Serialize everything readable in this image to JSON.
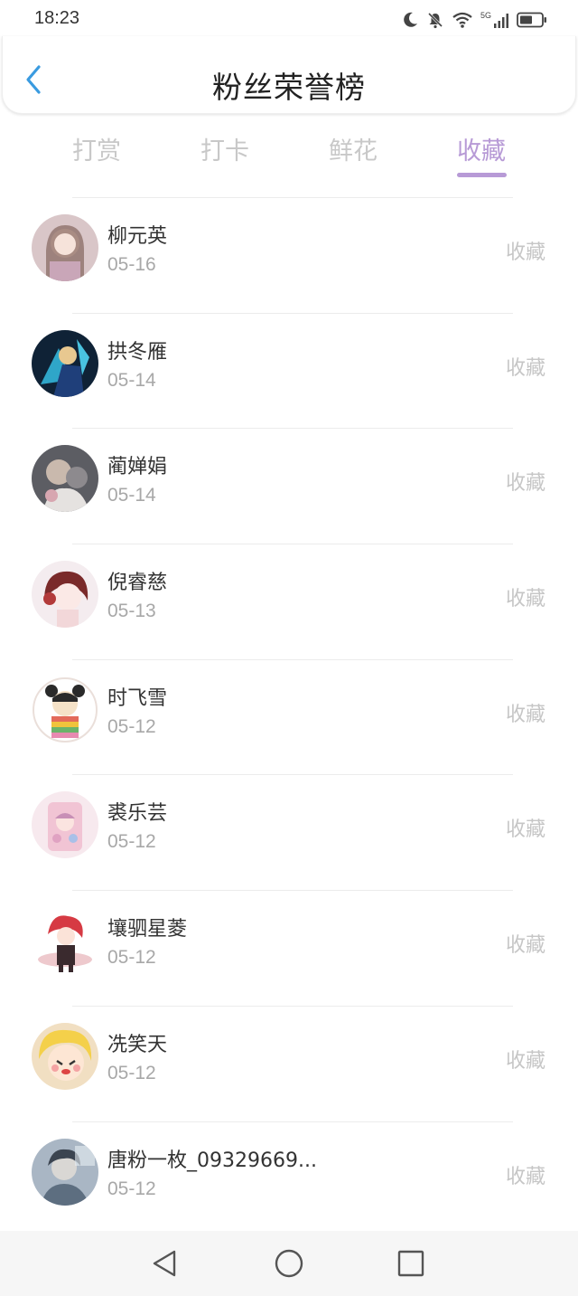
{
  "status": {
    "time": "18:23",
    "network": "5G"
  },
  "header": {
    "title": "粉丝荣誉榜"
  },
  "tabs": [
    {
      "label": "打赏"
    },
    {
      "label": "打卡"
    },
    {
      "label": "鲜花"
    },
    {
      "label": "收藏"
    }
  ],
  "active_tab_index": 3,
  "accent_color": "#b79ad6",
  "back_color": "#3a9be0",
  "fans": [
    {
      "name": "柳元英",
      "date": "05-16",
      "action": "收藏"
    },
    {
      "name": "拱冬雁",
      "date": "05-14",
      "action": "收藏"
    },
    {
      "name": "蔺婵娟",
      "date": "05-14",
      "action": "收藏"
    },
    {
      "name": "倪睿慈",
      "date": "05-13",
      "action": "收藏"
    },
    {
      "name": "时飞雪",
      "date": "05-12",
      "action": "收藏"
    },
    {
      "name": "裘乐芸",
      "date": "05-12",
      "action": "收藏"
    },
    {
      "name": "壤驷星菱",
      "date": "05-12",
      "action": "收藏"
    },
    {
      "name": "冼笑天",
      "date": "05-12",
      "action": "收藏"
    },
    {
      "name": "唐粉一枚_09329669...",
      "date": "05-12",
      "action": "收藏"
    }
  ]
}
